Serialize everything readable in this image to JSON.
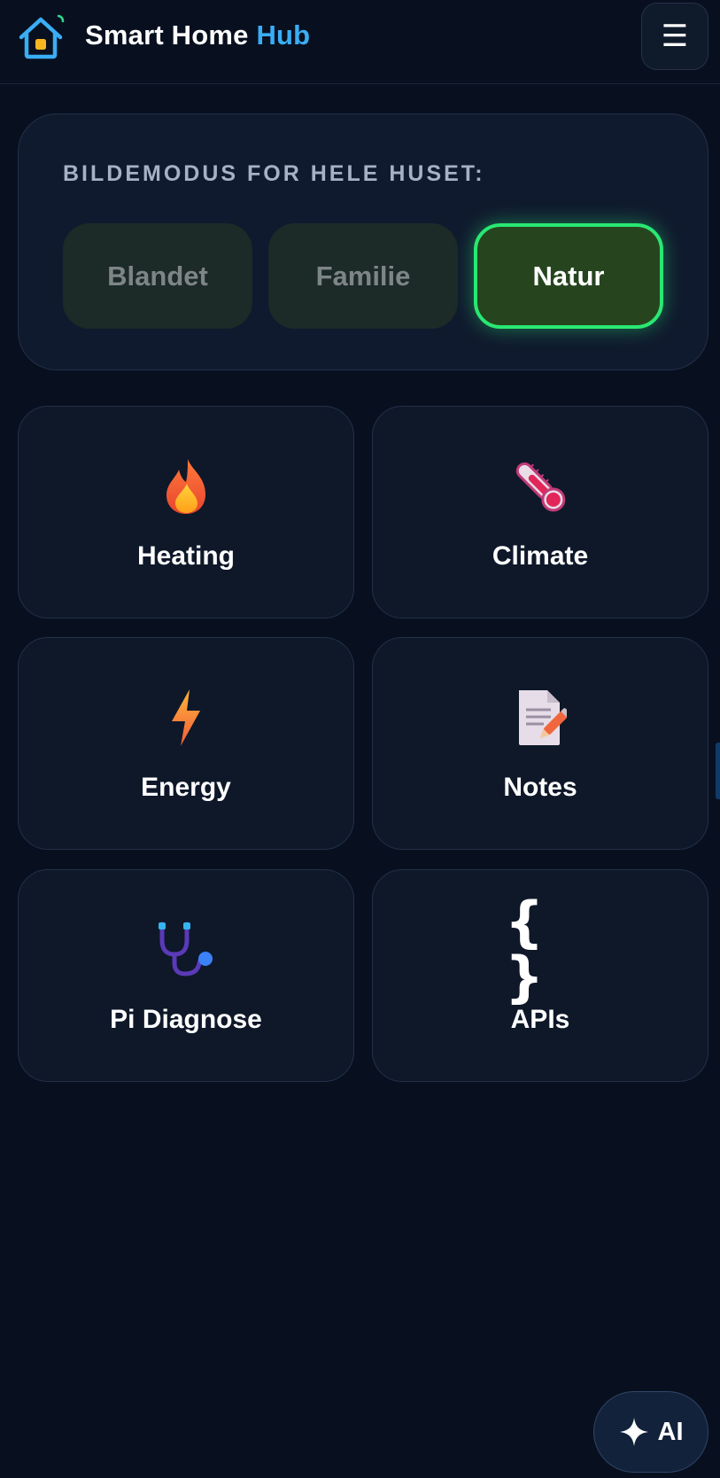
{
  "header": {
    "brand_main": "Smart Home ",
    "brand_accent": "Hub",
    "menu_icon": "☰"
  },
  "mode": {
    "title": "BILDEMODUS FOR HELE HUSET:",
    "options": [
      {
        "label": "Blandet",
        "selected": false
      },
      {
        "label": "Familie",
        "selected": false
      },
      {
        "label": "Natur",
        "selected": true
      }
    ]
  },
  "tiles": [
    {
      "label": "Heating",
      "icon": "flame-icon"
    },
    {
      "label": "Climate",
      "icon": "thermometer-icon"
    },
    {
      "label": "Energy",
      "icon": "lightning-icon"
    },
    {
      "label": "Notes",
      "icon": "memo-icon"
    },
    {
      "label": "Pi Diagnose",
      "icon": "stethoscope-icon"
    },
    {
      "label": "APIs",
      "icon": "braces-icon",
      "glyph": "{ }"
    }
  ],
  "ai_button": {
    "label": "AI",
    "icon": "sparkle-icon"
  },
  "colors": {
    "background": "#081020",
    "accent": "#3aaef5",
    "selected_border": "#29e872",
    "panel": "#101a2e"
  }
}
